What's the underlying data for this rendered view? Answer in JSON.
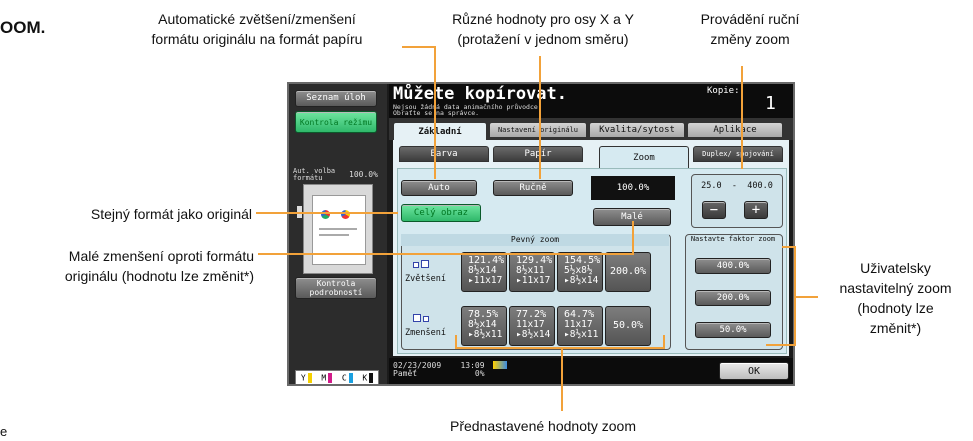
{
  "edge_left_text": "OOM.",
  "edge_bottom_text": "e",
  "annotations": {
    "auto_zoom": [
      "Automatické zvětšení/zmenšení",
      "formátu originálu na formát papíru"
    ],
    "xy_zoom": [
      "Různé hodnoty pro osy X a Y",
      "(protažení v jednom směru)"
    ],
    "manual_zoom": [
      "Provádění ruční",
      "změny zoom"
    ],
    "same_format": [
      "Stejný formát jako originál"
    ],
    "small_reduction": [
      "Malé zmenšení oproti formátu",
      "originálu (hodnotu lze změnit*)"
    ],
    "user_zoom": [
      "Uživatelsky",
      "nastavitelný zoom",
      "(hodnoty lze",
      "změnit*)"
    ],
    "presets": [
      "Přednastavené hodnoty zoom"
    ]
  },
  "screen": {
    "side": {
      "job_list": "Seznam úloh",
      "mode_check": "Kontrola režimu",
      "auto_format_label": "Aut. volba formátu",
      "auto_format_value": "100.0%",
      "detail_check": "Kontrola podrobností",
      "toner": [
        "Y",
        "M",
        "C",
        "K"
      ]
    },
    "header": {
      "title": "Můžete kopírovat.",
      "message": [
        "Nejsou žádná data animačního průvodce.",
        "Obraťte se na správce."
      ],
      "copies_label": "Kopie:",
      "copies_value": "1"
    },
    "main_tabs": [
      "Základní",
      "Nastavení originálu",
      "Kvalita/sytost",
      "Aplikace"
    ],
    "sub_tabs": [
      "Barva",
      "Papír",
      "Zoom",
      "Duplex/ spojování"
    ],
    "zoom": {
      "auto": "Auto",
      "manual": "Ručně",
      "current": "100.0%",
      "full_image": "Celý obraz",
      "small": "Malé",
      "range": "25.0  -  400.0",
      "minus": "−",
      "plus": "+"
    },
    "fixed_zoom": {
      "title": "Pevný zoom",
      "enlarge_label": "Zvětšení",
      "reduce_label": "Zmenšení",
      "enlarge": [
        {
          "pct": "121.4%",
          "l1": "8½x14",
          "l2": "▸11x17"
        },
        {
          "pct": "129.4%",
          "l1": "8½x11",
          "l2": "▸11x17"
        },
        {
          "pct": "154.5%",
          "l1": "5½x8½",
          "l2": "▸8½x14"
        },
        {
          "pct": "200.0%"
        }
      ],
      "reduce": [
        {
          "pct": "78.5%",
          "l1": "8½x14",
          "l2": "▸8½x11"
        },
        {
          "pct": "77.2%",
          "l1": "11x17",
          "l2": "▸8½x14"
        },
        {
          "pct": "64.7%",
          "l1": "11x17",
          "l2": "▸8½x11"
        },
        {
          "pct": "50.0%"
        }
      ]
    },
    "user_zoom": {
      "title": "Nastavte faktor zoom",
      "values": [
        "400.0%",
        "200.0%",
        "50.0%"
      ]
    },
    "status": {
      "date": "02/23/2009",
      "time": "13:09",
      "memory_label": "Paměť",
      "memory_value": "0%"
    },
    "ok": "OK"
  }
}
